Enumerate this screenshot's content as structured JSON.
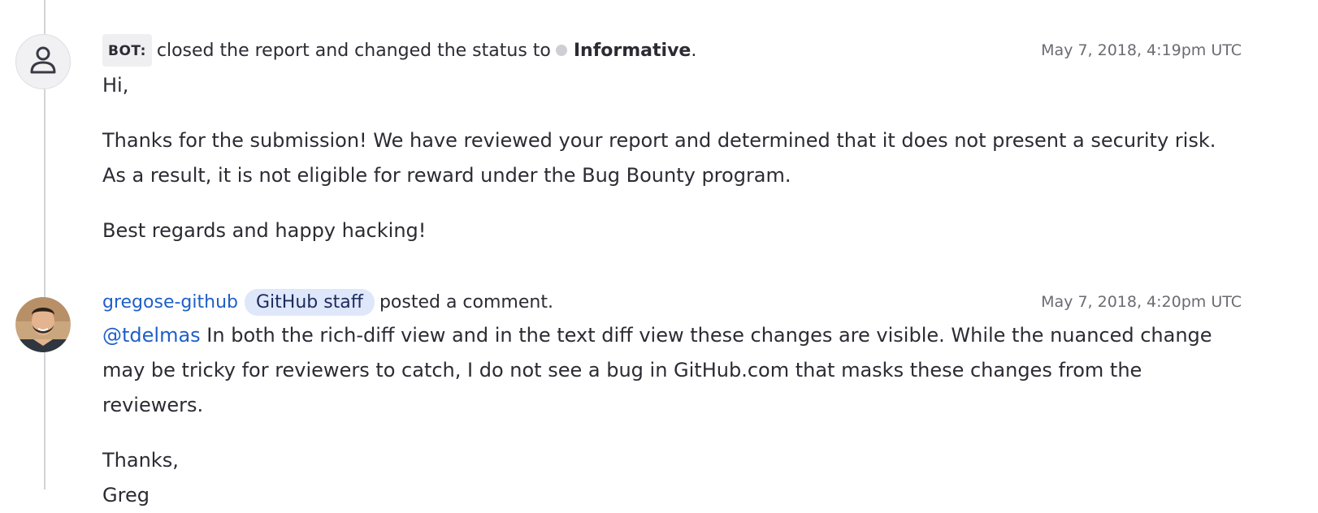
{
  "activities": [
    {
      "actor_tag": "BOT:",
      "action_text": "closed the report and changed the status to",
      "status": "Informative",
      "status_suffix": ".",
      "timestamp": "May 7, 2018, 4:19pm UTC",
      "paragraphs": [
        "Hi,",
        "Thanks for the submission! We have reviewed your report and determined that it does not present a security risk. As a result, it is not eligible for reward under the Bug Bounty program.",
        "Best regards and happy hacking!"
      ]
    },
    {
      "username": "gregose-github",
      "badge": "GitHub staff",
      "action_text": "posted a comment.",
      "timestamp": "May 7, 2018, 4:20pm UTC",
      "mention": "@tdelmas",
      "first_paragraph_rest": " In both the rich-diff view and in the text diff view these changes are visible. While the nuanced change may be tricky for reviewers to catch, I do not see a bug in GitHub.com that masks these changes from the reviewers.",
      "closing_line1": "Thanks,",
      "closing_line2": "Greg"
    }
  ],
  "icons": {
    "bot_avatar": "person-icon",
    "user_avatar": "user-photo-avatar"
  },
  "colors": {
    "link": "#1f5fc9",
    "badge_bg": "#dfe7fb",
    "status_dot": "#cfcfd3"
  }
}
